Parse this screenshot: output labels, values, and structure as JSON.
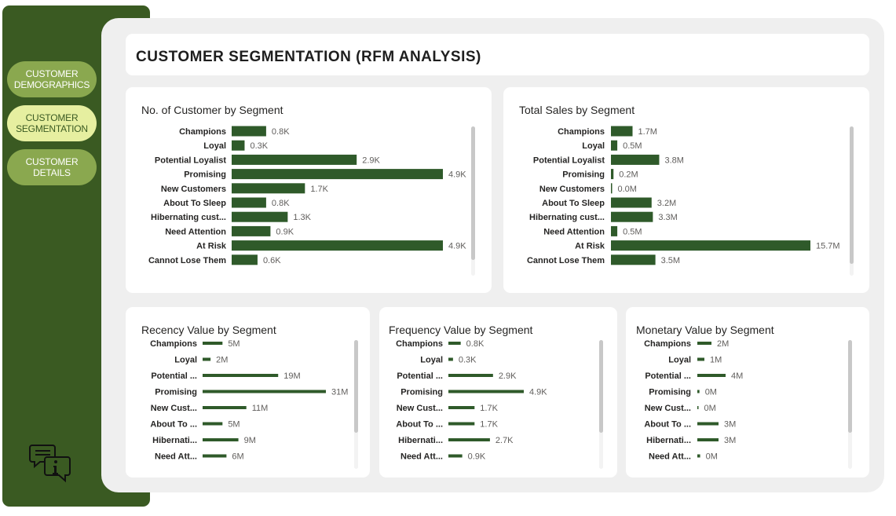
{
  "nav": {
    "demographics": [
      "CUSTOMER",
      "DEMOGRAPHICS"
    ],
    "segmentation": [
      "CUSTOMER",
      "SEGMENTATION"
    ],
    "details": [
      "CUSTOMER",
      "DETAILS"
    ]
  },
  "page": {
    "title": "CUSTOMER SEGMENTATION (RFM ANALYSIS)"
  },
  "colors": {
    "bar": "#2f5a2a",
    "sidebar": "#3a5a22",
    "nav_button": "#8aa84f",
    "nav_button_active": "#e6efa0"
  },
  "icons": {
    "info": "chat-info-icon"
  },
  "chart_data": [
    {
      "id": "customers",
      "type": "bar",
      "orientation": "horizontal",
      "title": "No. of Customer by Segment",
      "categories": [
        "Champions",
        "Loyal",
        "Potential Loyalist",
        "Promising",
        "New Customers",
        "About To Sleep",
        "Hibernating cust...",
        "Need Attention",
        "At Risk",
        "Cannot Lose Them"
      ],
      "values": [
        0.8,
        0.3,
        2.9,
        4.9,
        1.7,
        0.8,
        1.3,
        0.9,
        4.9,
        0.6
      ],
      "labels": [
        "0.8K",
        "0.3K",
        "2.9K",
        "4.9K",
        "1.7K",
        "0.8K",
        "1.3K",
        "0.9K",
        "4.9K",
        "0.6K"
      ],
      "unit": "K"
    },
    {
      "id": "sales",
      "type": "bar",
      "orientation": "horizontal",
      "title": "Total Sales by Segment",
      "categories": [
        "Champions",
        "Loyal",
        "Potential Loyalist",
        "Promising",
        "New Customers",
        "About To Sleep",
        "Hibernating cust...",
        "Need Attention",
        "At Risk",
        "Cannot Lose Them"
      ],
      "values": [
        1.7,
        0.5,
        3.8,
        0.2,
        0.0,
        3.2,
        3.3,
        0.5,
        15.7,
        3.5
      ],
      "labels": [
        "1.7M",
        "0.5M",
        "3.8M",
        "0.2M",
        "0.0M",
        "3.2M",
        "3.3M",
        "0.5M",
        "15.7M",
        "3.5M"
      ],
      "unit": "M"
    },
    {
      "id": "recency",
      "type": "bar",
      "orientation": "horizontal",
      "title": "Recency Value by Segment",
      "categories": [
        "Champions",
        "Loyal",
        "Potential ...",
        "Promising",
        "New Cust...",
        "About To ...",
        "Hibernati...",
        "Need Att..."
      ],
      "values": [
        5,
        2,
        19,
        31,
        11,
        5,
        9,
        6
      ],
      "labels": [
        "5M",
        "2M",
        "19M",
        "31M",
        "11M",
        "5M",
        "9M",
        "6M"
      ],
      "unit": "M"
    },
    {
      "id": "frequency",
      "type": "bar",
      "orientation": "horizontal",
      "title": "Frequency Value by Segment",
      "categories": [
        "Champions",
        "Loyal",
        "Potential ...",
        "Promising",
        "New Cust...",
        "About To ...",
        "Hibernati...",
        "Need Att..."
      ],
      "values": [
        0.8,
        0.3,
        2.9,
        4.9,
        1.7,
        1.7,
        2.7,
        0.9
      ],
      "labels": [
        "0.8K",
        "0.3K",
        "2.9K",
        "4.9K",
        "1.7K",
        "1.7K",
        "2.7K",
        "0.9K"
      ],
      "unit": "K"
    },
    {
      "id": "monetary",
      "type": "bar",
      "orientation": "horizontal",
      "title": "Monetary Value by Segment",
      "categories": [
        "Champions",
        "Loyal",
        "Potential ...",
        "Promising",
        "New Cust...",
        "About To ...",
        "Hibernati...",
        "Need Att..."
      ],
      "values": [
        2,
        1,
        4,
        0.3,
        0.1,
        3,
        3,
        0.4
      ],
      "labels": [
        "2M",
        "1M",
        "4M",
        "0M",
        "0M",
        "3M",
        "3M",
        "0M"
      ],
      "unit": "M"
    }
  ]
}
